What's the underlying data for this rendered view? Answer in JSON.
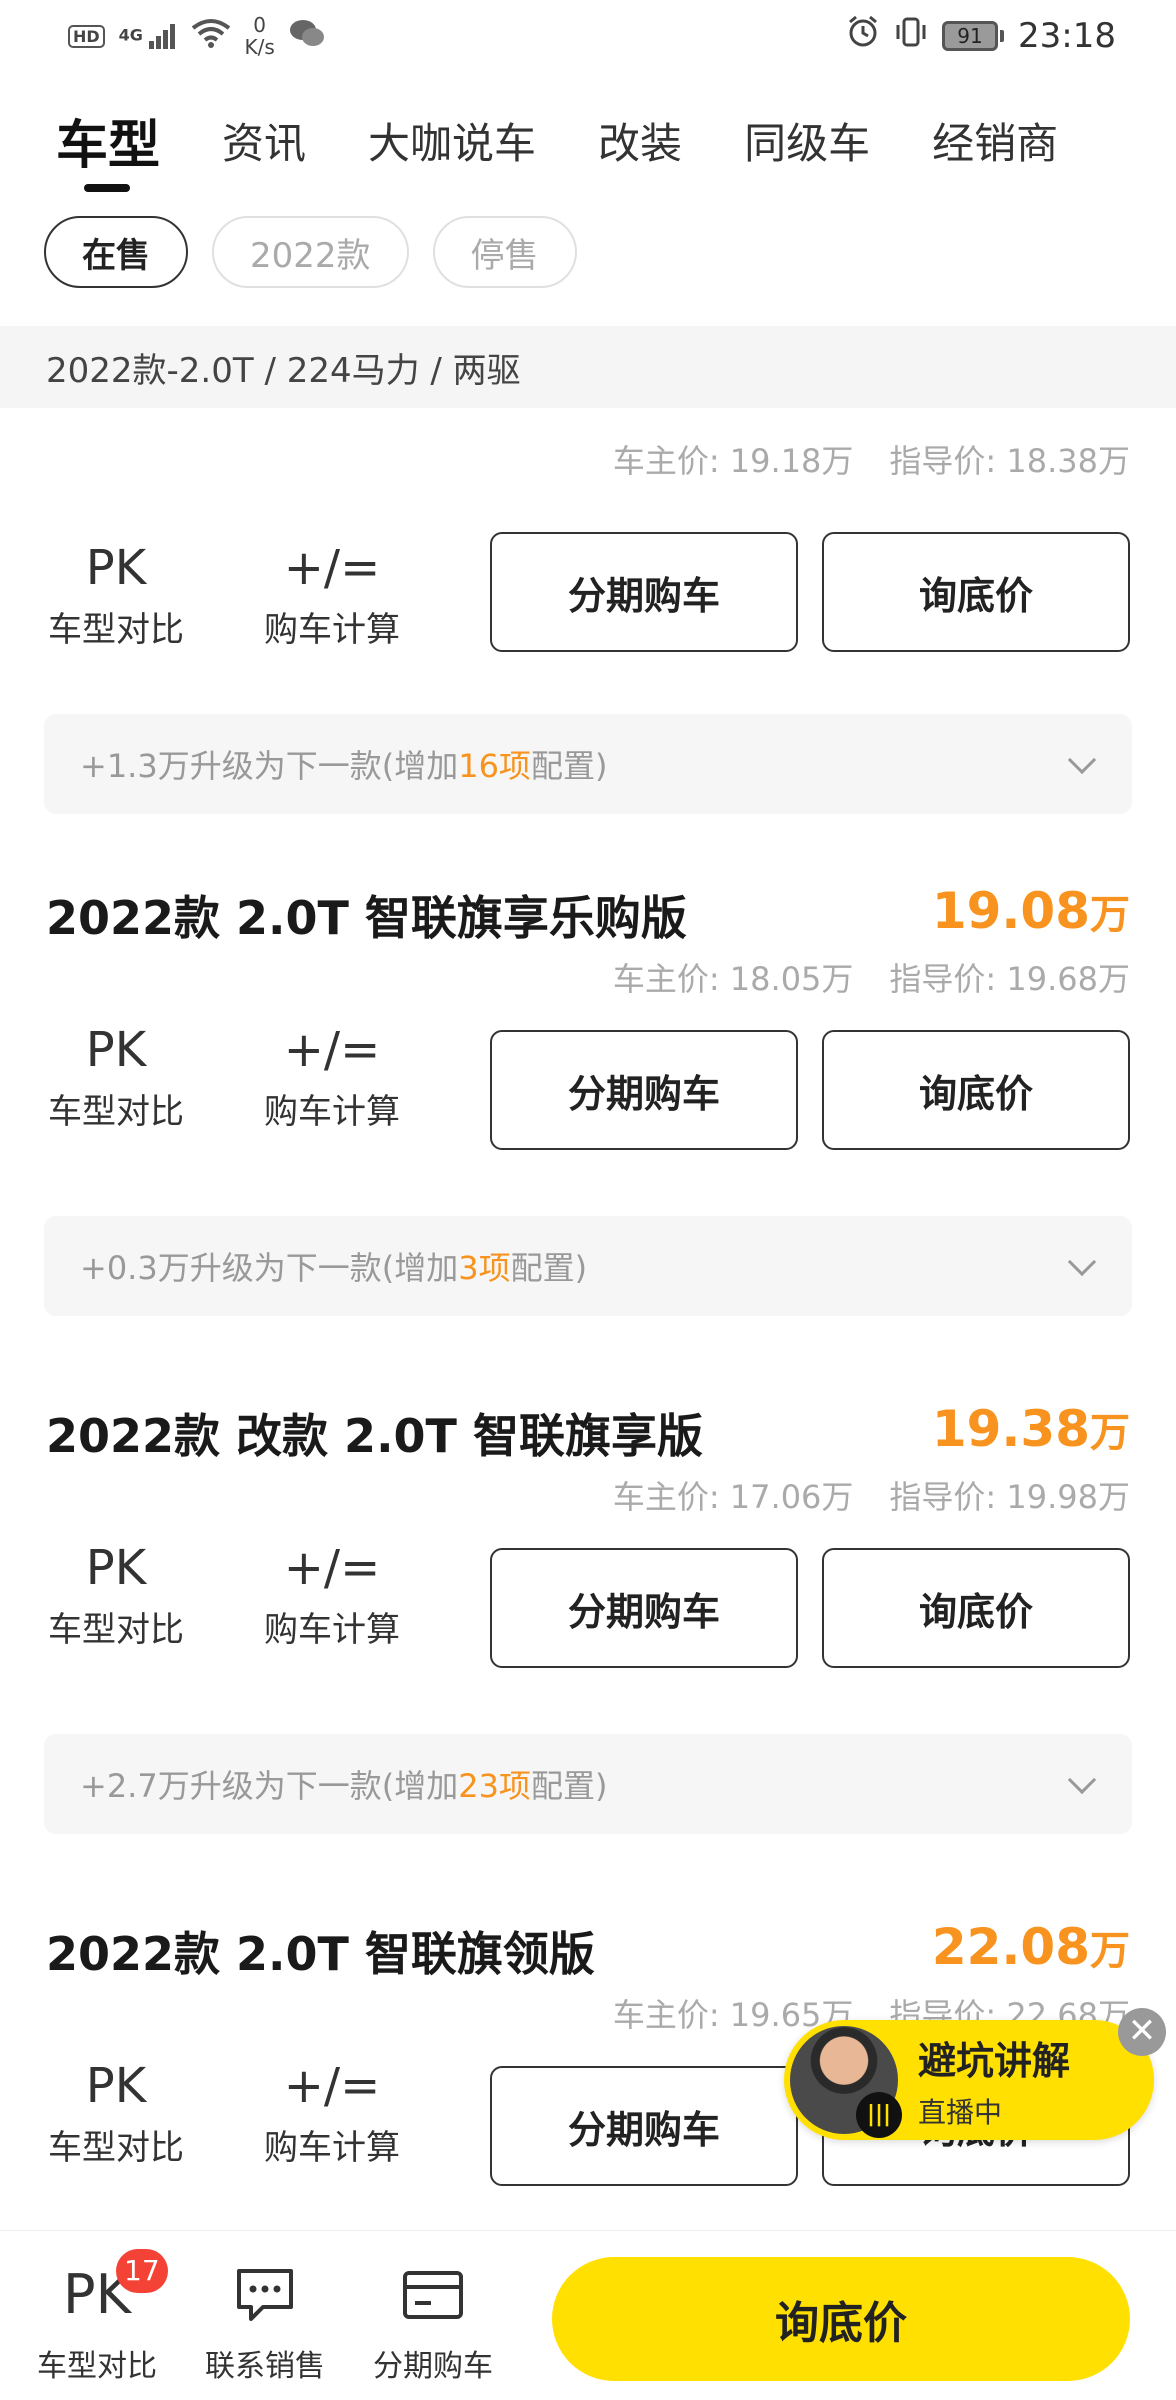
{
  "status_bar": {
    "hd": "HD",
    "network": "4G",
    "speed_value": "0",
    "speed_unit": "K/s",
    "battery": "91",
    "time": "23:18"
  },
  "tabs": [
    {
      "label": "车型",
      "active": true
    },
    {
      "label": "资讯"
    },
    {
      "label": "大咖说车"
    },
    {
      "label": "改装"
    },
    {
      "label": "同级车"
    },
    {
      "label": "经销商"
    }
  ],
  "filters": [
    {
      "label": "在售",
      "active": true
    },
    {
      "label": "2022款"
    },
    {
      "label": "停售"
    }
  ],
  "group_header": "2022款-2.0T / 224马力 / 两驱",
  "tools": {
    "pk_icon": "PK",
    "pk_label": "车型对比",
    "calc_label": "购车计算"
  },
  "buttons": {
    "finance": "分期购车",
    "ask": "询底价"
  },
  "cards": [
    {
      "title": "",
      "price": "",
      "unit": "",
      "owner_price": "车主价: 19.18万",
      "guide_price": "指导价: 18.38万",
      "upgrade": {
        "prefix": "+1.3万升级为下一款(增加",
        "count": "16项",
        "suffix": "配置)"
      }
    },
    {
      "title": "2022款 2.0T 智联旗享乐购版",
      "price": "19.08",
      "unit": "万",
      "owner_price": "车主价: 18.05万",
      "guide_price": "指导价: 19.68万",
      "upgrade": {
        "prefix": "+0.3万升级为下一款(增加",
        "count": "3项",
        "suffix": "配置)"
      }
    },
    {
      "title": "2022款 改款 2.0T 智联旗享版",
      "price": "19.38",
      "unit": "万",
      "owner_price": "车主价: 17.06万",
      "guide_price": "指导价: 19.98万",
      "upgrade": {
        "prefix": "+2.7万升级为下一款(增加",
        "count": "23项",
        "suffix": "配置)"
      }
    },
    {
      "title": "2022款 2.0T 智联旗领版",
      "price": "22.08",
      "unit": "万",
      "owner_price": "车主价: 19.65万",
      "guide_price": "指导价: 22.68万"
    }
  ],
  "live": {
    "title": "避坑讲解",
    "status": "直播中",
    "close": "✕"
  },
  "bottom_bar": {
    "compare_label": "车型对比",
    "compare_badge": "17",
    "contact_label": "联系销售",
    "finance_label": "分期购车",
    "ask_label": "询底价"
  },
  "colors": {
    "accent": "#f7931e",
    "primary_yellow": "#ffe000",
    "badge": "#f44336"
  }
}
